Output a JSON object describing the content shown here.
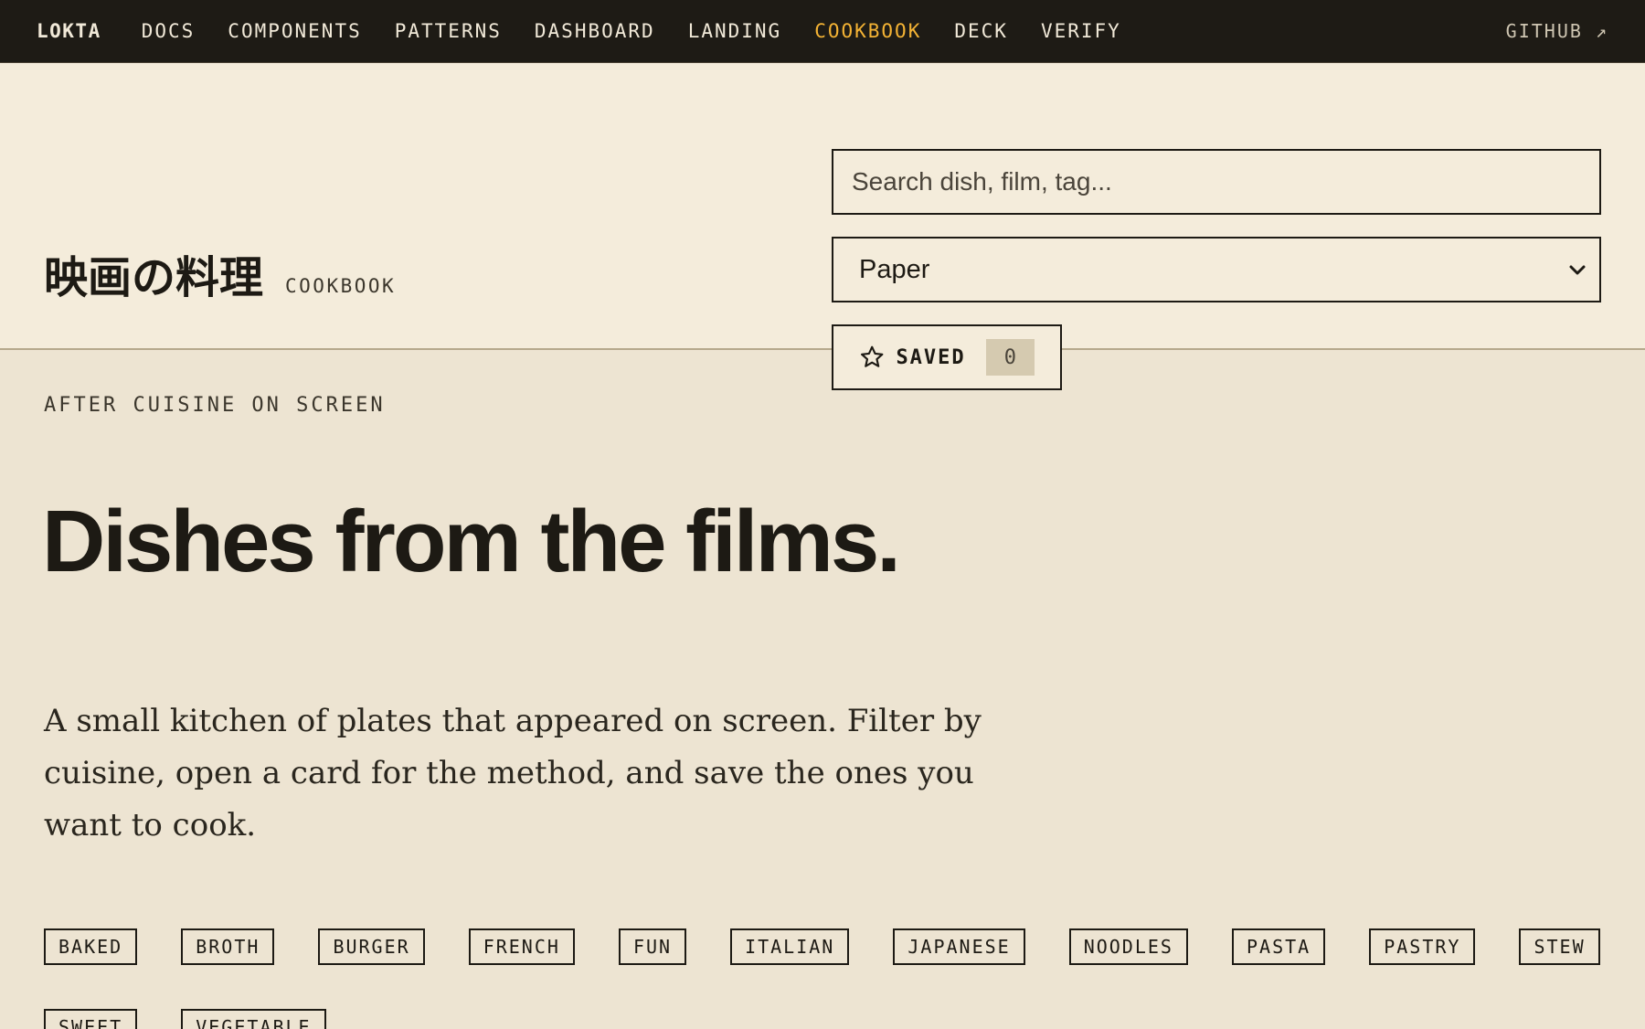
{
  "nav": {
    "brand": "LOKTA",
    "links": [
      {
        "label": "DOCS",
        "active": false
      },
      {
        "label": "COMPONENTS",
        "active": false
      },
      {
        "label": "PATTERNS",
        "active": false
      },
      {
        "label": "DASHBOARD",
        "active": false
      },
      {
        "label": "LANDING",
        "active": false
      },
      {
        "label": "COOKBOOK",
        "active": true
      },
      {
        "label": "DECK",
        "active": false
      },
      {
        "label": "VERIFY",
        "active": false
      }
    ],
    "github": "GITHUB ↗",
    "active_color": "#f4b334"
  },
  "header": {
    "title_jp": "映画の料理",
    "title_sub": "COOKBOOK",
    "search_placeholder": "Search dish, film, tag...",
    "theme_select": "Paper",
    "saved_label": "SAVED",
    "saved_count": "0"
  },
  "main": {
    "eyebrow": "AFTER CUISINE ON SCREEN",
    "headline": "Dishes from the films.",
    "lede": "A small kitchen of plates that appeared on screen. Filter by cuisine, open a card for the method, and save the ones you want to cook.",
    "tags": [
      "BAKED",
      "BROTH",
      "BURGER",
      "FRENCH",
      "FUN",
      "ITALIAN",
      "JAPANESE",
      "NOODLES",
      "PASTA",
      "PASTRY",
      "STEW",
      "SWEET",
      "VEGETABLE"
    ]
  },
  "icons": {
    "saved": "star-icon",
    "select": "chevron-down-icon"
  }
}
